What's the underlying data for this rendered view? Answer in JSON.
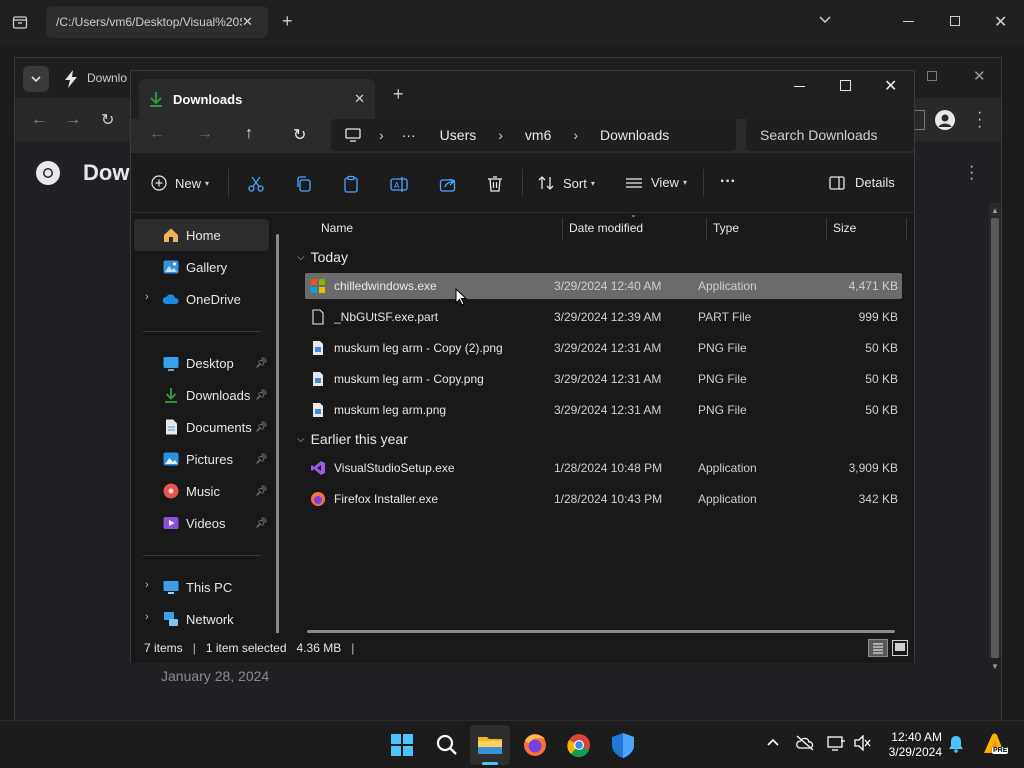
{
  "outer_browser": {
    "tab_title": "/C:/Users/vm6/Desktop/Visual%20S"
  },
  "chrome_window": {
    "tab_title": "Downlo",
    "page_heading": "Dow",
    "date_text": "January 28, 2024"
  },
  "explorer": {
    "tab_title": "Downloads",
    "breadcrumb": [
      "Users",
      "vm6",
      "Downloads"
    ],
    "breadcrumb_more": "···",
    "search_placeholder": "Search Downloads",
    "toolbar": {
      "new_label": "New",
      "sort_label": "Sort",
      "view_label": "View",
      "more_label": "···",
      "details_label": "Details"
    },
    "columns": {
      "name": "Name",
      "date": "Date modified",
      "type": "Type",
      "size": "Size"
    },
    "groups": {
      "today": "Today",
      "earlier": "Earlier this year"
    },
    "files_today": [
      {
        "name": "chilledwindows.exe",
        "date": "3/29/2024 12:40 AM",
        "type": "Application",
        "size": "4,471 KB"
      },
      {
        "name": "_NbGUtSF.exe.part",
        "date": "3/29/2024 12:39 AM",
        "type": "PART File",
        "size": "999 KB"
      },
      {
        "name": "muskum leg arm - Copy (2).png",
        "date": "3/29/2024 12:31 AM",
        "type": "PNG File",
        "size": "50 KB"
      },
      {
        "name": "muskum leg arm - Copy.png",
        "date": "3/29/2024 12:31 AM",
        "type": "PNG File",
        "size": "50 KB"
      },
      {
        "name": "muskum leg arm.png",
        "date": "3/29/2024 12:31 AM",
        "type": "PNG File",
        "size": "50 KB"
      }
    ],
    "files_earlier": [
      {
        "name": "VisualStudioSetup.exe",
        "date": "1/28/2024 10:48 PM",
        "type": "Application",
        "size": "3,909 KB"
      },
      {
        "name": "Firefox Installer.exe",
        "date": "1/28/2024 10:43 PM",
        "type": "Application",
        "size": "342 KB"
      }
    ],
    "sidebar": {
      "home": "Home",
      "gallery": "Gallery",
      "onedrive": "OneDrive",
      "desktop": "Desktop",
      "downloads": "Downloads",
      "documents": "Documents",
      "pictures": "Pictures",
      "music": "Music",
      "videos": "Videos",
      "thispc": "This PC",
      "network": "Network"
    },
    "status": {
      "items": "7 items",
      "selected": "1 item selected",
      "size": "4.36 MB"
    }
  },
  "taskbar": {
    "time": "12:40 AM",
    "date": "3/29/2024",
    "badge": "PRE"
  },
  "colors": {
    "selection": "#6b6b6b",
    "accent_green": "#2ea043",
    "window_bg": "#191919"
  }
}
